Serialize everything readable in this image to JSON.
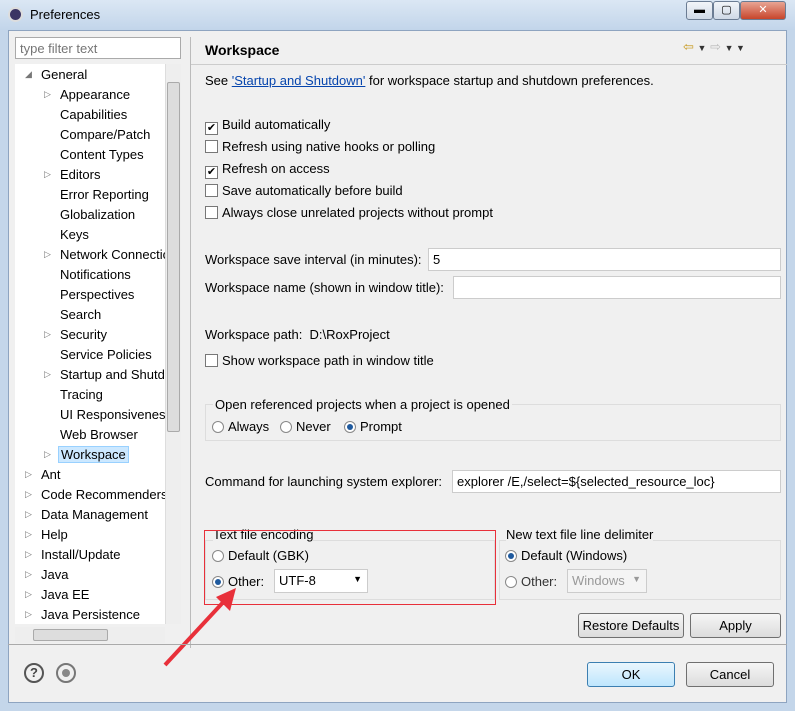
{
  "window": {
    "title": "Preferences",
    "minimize": "▬",
    "maximize": "▢",
    "close": "✕"
  },
  "filter": {
    "placeholder": "type filter text"
  },
  "tree": [
    {
      "label": "General",
      "level": 0,
      "state": "expanded"
    },
    {
      "label": "Appearance",
      "level": 1,
      "state": "collapsed"
    },
    {
      "label": "Capabilities",
      "level": 1,
      "state": "leaf"
    },
    {
      "label": "Compare/Patch",
      "level": 1,
      "state": "leaf"
    },
    {
      "label": "Content Types",
      "level": 1,
      "state": "leaf"
    },
    {
      "label": "Editors",
      "level": 1,
      "state": "collapsed"
    },
    {
      "label": "Error Reporting",
      "level": 1,
      "state": "leaf"
    },
    {
      "label": "Globalization",
      "level": 1,
      "state": "leaf"
    },
    {
      "label": "Keys",
      "level": 1,
      "state": "leaf"
    },
    {
      "label": "Network Connections",
      "level": 1,
      "state": "collapsed"
    },
    {
      "label": "Notifications",
      "level": 1,
      "state": "leaf"
    },
    {
      "label": "Perspectives",
      "level": 1,
      "state": "leaf"
    },
    {
      "label": "Search",
      "level": 1,
      "state": "leaf"
    },
    {
      "label": "Security",
      "level": 1,
      "state": "collapsed"
    },
    {
      "label": "Service Policies",
      "level": 1,
      "state": "leaf"
    },
    {
      "label": "Startup and Shutdown",
      "level": 1,
      "state": "collapsed"
    },
    {
      "label": "Tracing",
      "level": 1,
      "state": "leaf"
    },
    {
      "label": "UI Responsiveness",
      "level": 1,
      "state": "leaf"
    },
    {
      "label": "Web Browser",
      "level": 1,
      "state": "leaf"
    },
    {
      "label": "Workspace",
      "level": 1,
      "state": "collapsed",
      "selected": true
    },
    {
      "label": "Ant",
      "level": 0,
      "state": "collapsed"
    },
    {
      "label": "Code Recommenders",
      "level": 0,
      "state": "collapsed"
    },
    {
      "label": "Data Management",
      "level": 0,
      "state": "collapsed"
    },
    {
      "label": "Help",
      "level": 0,
      "state": "collapsed"
    },
    {
      "label": "Install/Update",
      "level": 0,
      "state": "collapsed"
    },
    {
      "label": "Java",
      "level": 0,
      "state": "collapsed"
    },
    {
      "label": "Java EE",
      "level": 0,
      "state": "collapsed"
    },
    {
      "label": "Java Persistence",
      "level": 0,
      "state": "collapsed"
    }
  ],
  "page": {
    "title": "Workspace",
    "intro_pre": "See ",
    "intro_link": "'Startup and Shutdown'",
    "intro_post": " for workspace startup and shutdown preferences.",
    "checkboxes": [
      {
        "label": "Build automatically",
        "checked": true
      },
      {
        "label": "Refresh using native hooks or polling",
        "checked": false
      },
      {
        "label": "Refresh on access",
        "checked": true
      },
      {
        "label": "Save automatically before build",
        "checked": false
      },
      {
        "label": "Always close unrelated projects without prompt",
        "checked": false
      }
    ],
    "save_interval_label": "Workspace save interval (in minutes):",
    "save_interval_value": "5",
    "ws_name_label": "Workspace name (shown in window title):",
    "ws_name_value": "",
    "ws_path_label": "Workspace path:",
    "ws_path_value": "D:\\RoxProject",
    "show_path_label": "Show workspace path in window title",
    "open_ref_label": "Open referenced projects when a project is opened",
    "open_ref_options": [
      "Always",
      "Never",
      "Prompt"
    ],
    "open_ref_selected": "Prompt",
    "cmd_label": "Command for launching system explorer:",
    "cmd_value": "explorer /E,/select=${selected_resource_loc}",
    "encoding": {
      "label": "Text file encoding",
      "default_label": "Default (GBK)",
      "other_label": "Other:",
      "value": "UTF-8",
      "selected": "Other"
    },
    "delimiter": {
      "label": "New text file line delimiter",
      "default_label": "Default (Windows)",
      "other_label": "Other:",
      "value": "Windows",
      "selected": "Default"
    },
    "restore_defaults": "Restore Defaults",
    "apply": "Apply"
  },
  "footer": {
    "help": "?",
    "ok": "OK",
    "cancel": "Cancel"
  },
  "colors": {
    "annotation": "#e8303a",
    "selection": "#cce8ff",
    "link": "#0645ad"
  }
}
